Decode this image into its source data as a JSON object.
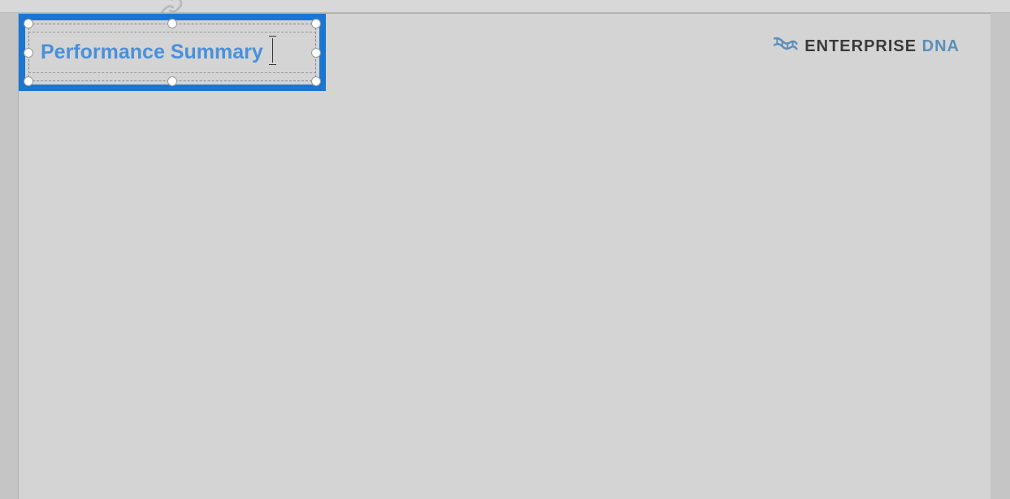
{
  "textbox": {
    "title": "Performance Summary",
    "selected": true,
    "editing": true
  },
  "logo": {
    "enterprise_text": "ENTERPRISE ",
    "dna_text": "DNA",
    "icon": "dna-helix-icon"
  },
  "colors": {
    "selection_blue": "#1976d2",
    "title_blue": "#4a90d9",
    "canvas_bg": "#d4d4d4",
    "logo_dark": "#3a3a3a",
    "logo_blue": "#5b8fb9"
  }
}
